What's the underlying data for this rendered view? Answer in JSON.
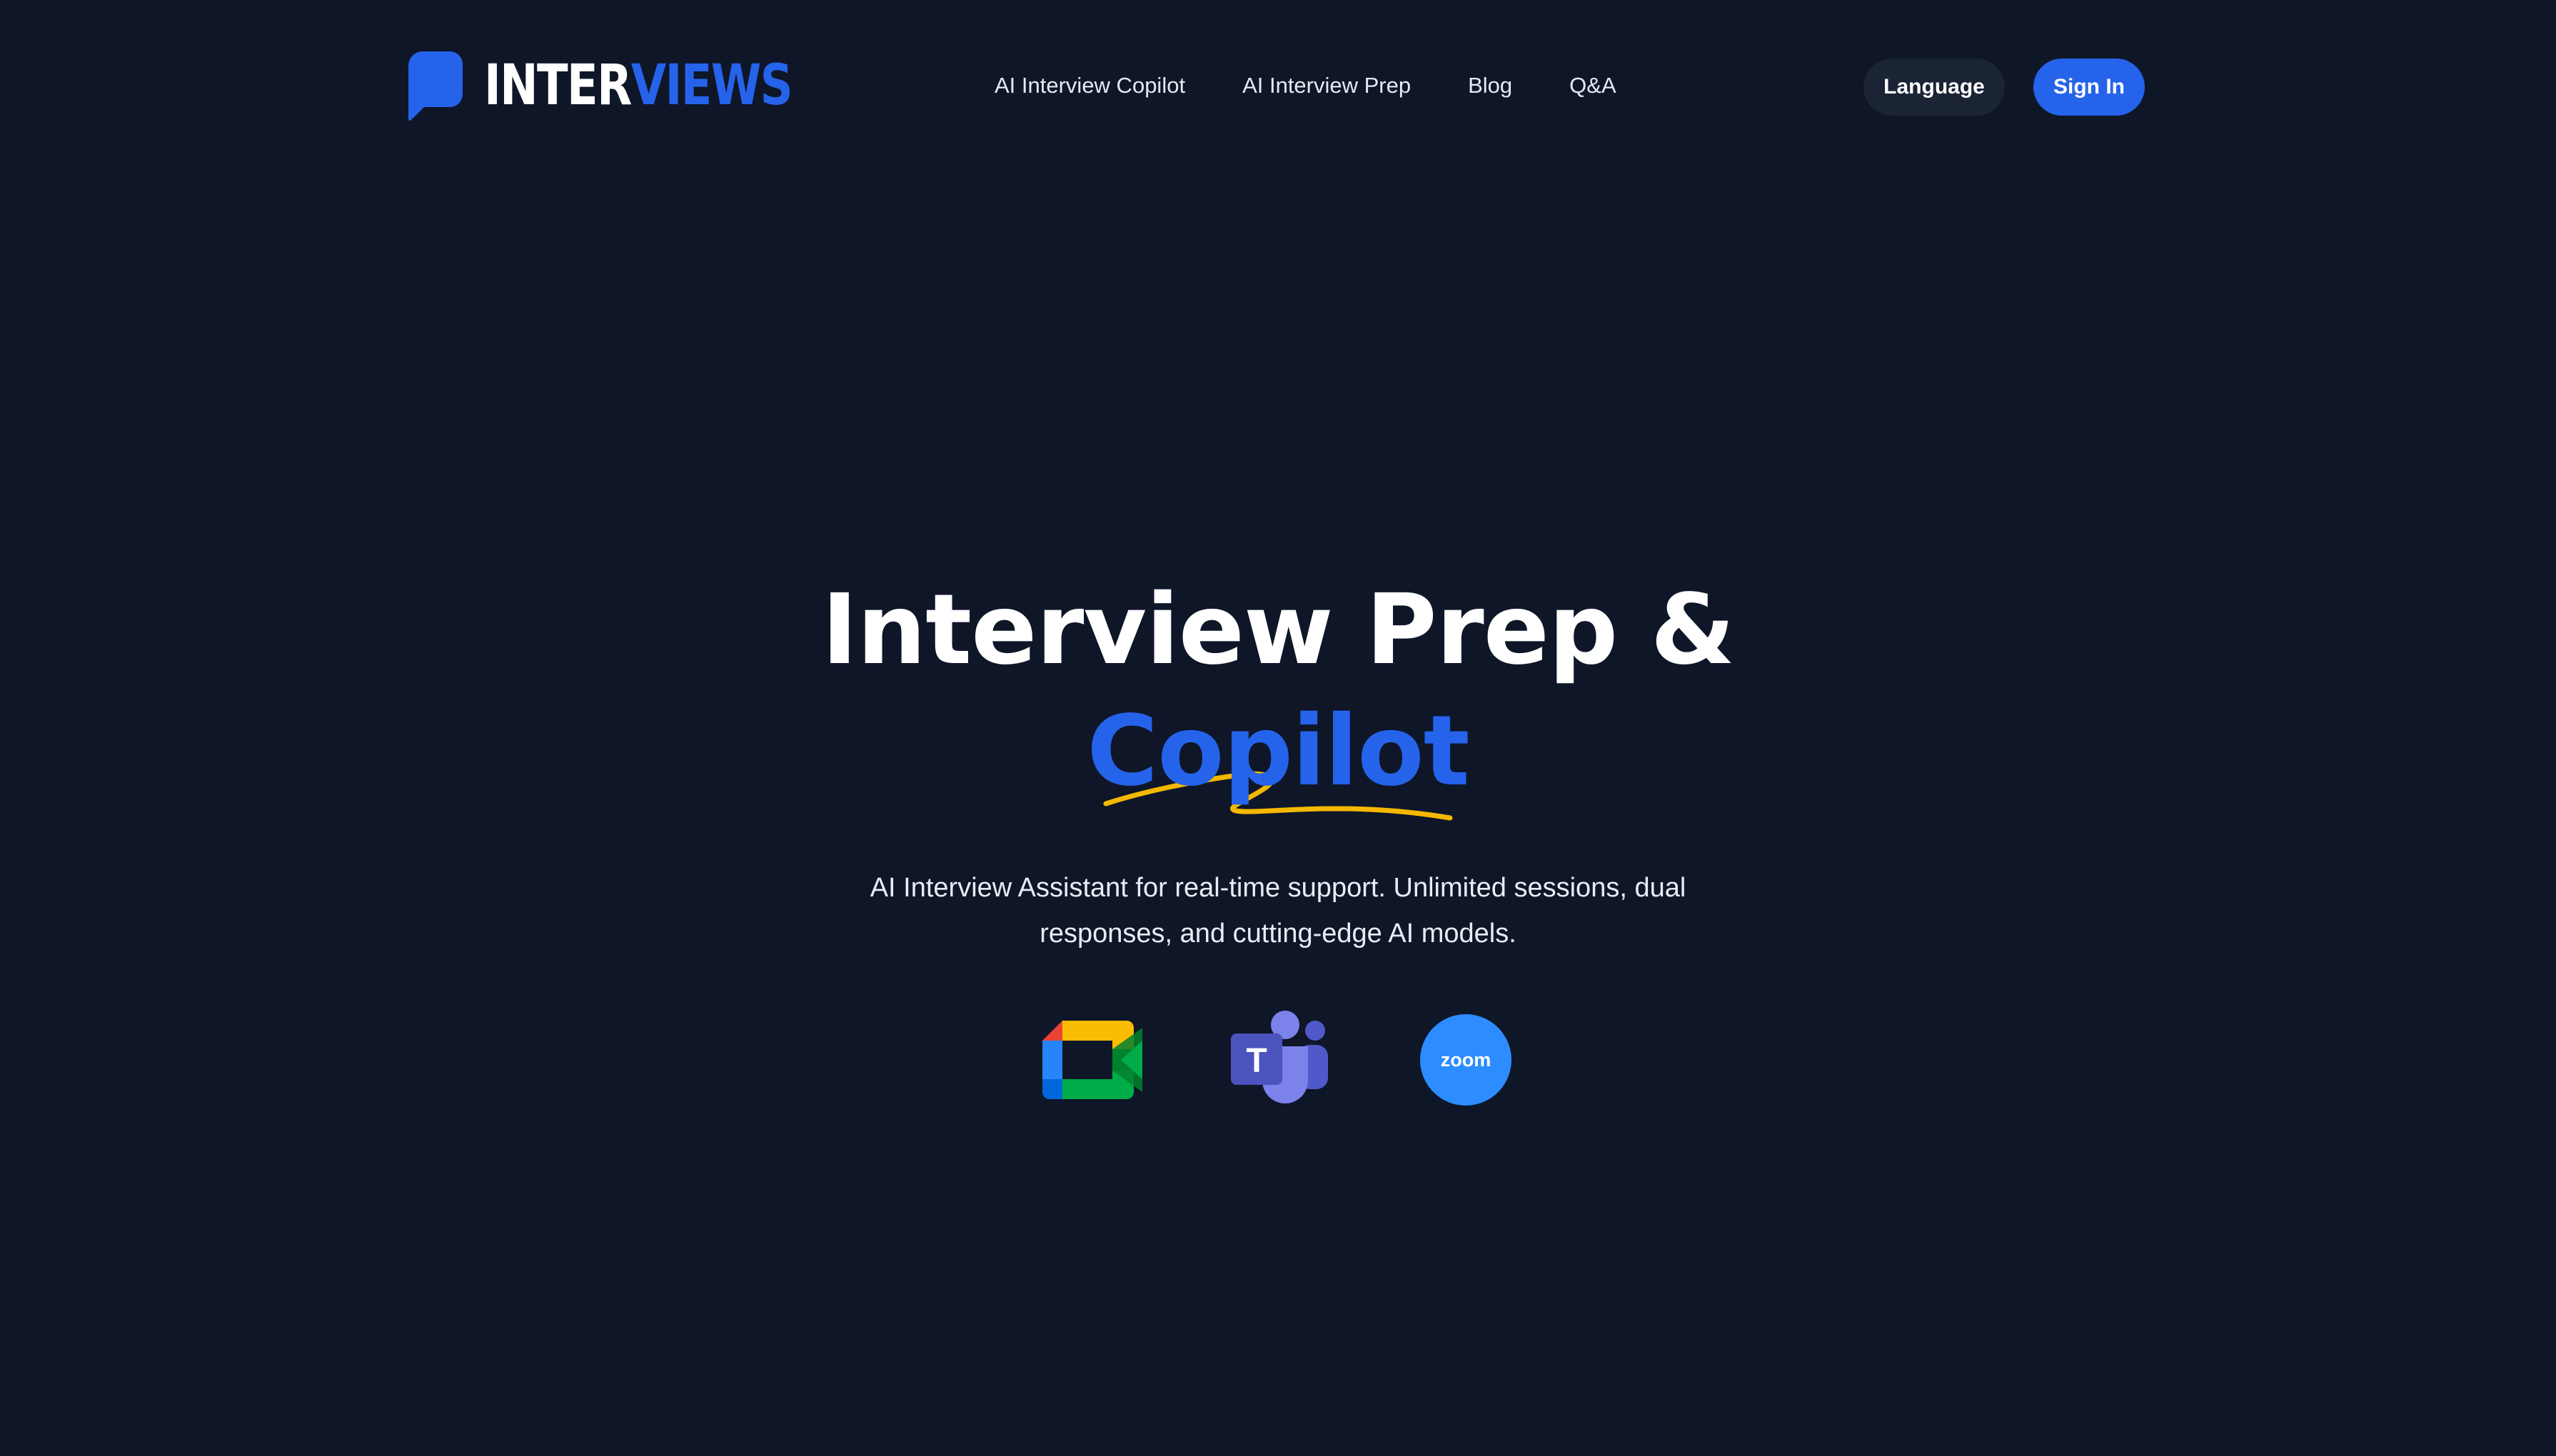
{
  "brand": {
    "name_part1": "INTER",
    "name_part2": "VIEWS",
    "icon": "speech-bubble-icon",
    "accent_color": "#2563eb"
  },
  "nav": {
    "items": [
      {
        "label": "AI Interview Copilot"
      },
      {
        "label": "AI Interview Prep"
      },
      {
        "label": "Blog"
      },
      {
        "label": "Q&A"
      }
    ]
  },
  "header_actions": {
    "language_label": "Language",
    "signin_label": "Sign In"
  },
  "hero": {
    "title_line1": "Interview Prep &",
    "title_line2": "Copilot",
    "subtitle": "AI Interview Assistant for real-time support. Unlimited sessions, dual responses, and cutting-edge AI models.",
    "underline_color": "#f5b800"
  },
  "integrations": [
    {
      "icon": "google-meet-icon"
    },
    {
      "icon": "microsoft-teams-icon",
      "letter": "T"
    },
    {
      "icon": "zoom-icon",
      "label": "zoom"
    }
  ],
  "colors": {
    "background": "#0e1628",
    "language_button": "#1b2434",
    "signin_button": "#2563eb"
  }
}
